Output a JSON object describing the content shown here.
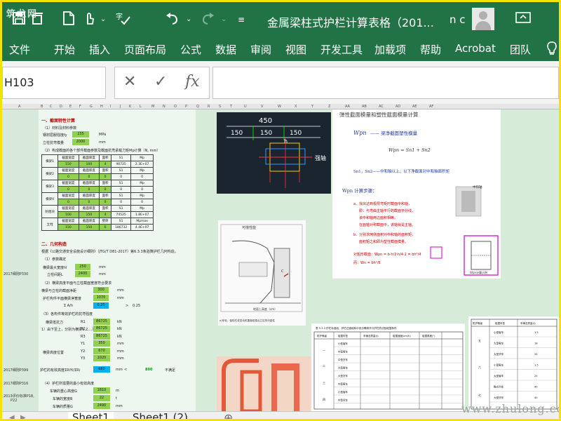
{
  "app": {
    "logo_text": "筑龙网",
    "title": "金属梁柱式护栏计算表格（201...",
    "user": "n c"
  },
  "menu": [
    "文件",
    "开始",
    "插入",
    "页面布局",
    "公式",
    "数据",
    "审阅",
    "视图",
    "开发工具",
    "加载项",
    "帮助",
    "Acrobat",
    "团队"
  ],
  "formula_bar": {
    "name_box": "H103",
    "value": ""
  },
  "columns": [
    "A",
    "B",
    "C",
    "D",
    "E",
    "F",
    "G",
    "H",
    "I",
    "J",
    "K",
    "L",
    "M",
    "N",
    "O",
    "P",
    "Q",
    "R",
    "S",
    "T",
    "U",
    "V",
    "W",
    "X",
    "Y",
    "Z",
    "AA",
    "AB",
    "AC",
    "AD",
    "AE",
    "AF"
  ],
  "sheet": {
    "section1": "一、截面特性计算",
    "s1_sub1": "（1）材料及材料参数",
    "yield_label": "钢材屈服强度fy",
    "yield_value": "235",
    "yield_unit": "MPa",
    "modulus_label": "立柱抗弯模量",
    "modulus_value": "2000",
    "modulus_unit": "mm",
    "s1_sub2": "（2）构成截面的各个部件截面参数及截面抗弯承载力矩Mp计算（N, mm）",
    "table_header": [
      "截面宽度",
      "截面厚度",
      "面积",
      "S1",
      "Mp"
    ],
    "table_rows": [
      {
        "label": "横梁1",
        "values": [
          "150",
          "100",
          "4",
          "96725",
          "2.3E+07"
        ]
      },
      {
        "label": "横梁2",
        "values": [
          "0",
          "0",
          "0",
          "0",
          "0"
        ]
      },
      {
        "label": "横梁3",
        "values": [
          "0",
          "0",
          "0",
          "0",
          "0"
        ]
      },
      {
        "label": "横梁4",
        "values": [
          "0",
          "0",
          "0",
          "0",
          "0"
        ]
      },
      {
        "label": "防阻块",
        "values": [
          "100",
          "150",
          "4",
          "74525",
          "1.8E+07"
        ]
      },
      {
        "label": "立柱",
        "values": [
          "150",
          "150",
          "6",
          "186732",
          "4.4E+07"
        ]
      }
    ],
    "table_sublabels": [
      "截面宽度",
      "截面厚度",
      "壁厚",
      "S1",
      "Mpmax"
    ],
    "section2": "二、几何构造",
    "s2_desc": "根据《公路交通安全设施设计细则》（JTG/T D81-2017）第6.3.3条验算护栏几何构造。",
    "ref_2017_a": "2017细则P330",
    "s2_sub1": "（1）参数确定",
    "ht_label": "横梁最大宽度hl",
    "ht_value": "250",
    "ht_unit": "mm",
    "dist_label": "立柱间距L",
    "dist_value": "2400",
    "dist_unit": "mm",
    "s2_sub2": "（2）横梁高度平面与立柱截面宽度符合要求",
    "c1_label": "横梁与立柱的截面净距",
    "c1_value": "300",
    "c1_unit": "mm",
    "c2_label": "护栏构件平面横梁净宽度",
    "c2_value": "1070",
    "c2_unit": "mm",
    "ratio_label": "Σ A/h",
    "ratio_value": "0.25",
    "ratio_cmp": ">",
    "ratio_limit": "0.25",
    "s2_sub3": "（3）各构件等效护栏的抗弯强度",
    "rows_r": [
      {
        "label": "R1",
        "value": "86725",
        "unit": "kN"
      },
      {
        "label": "R2",
        "value": "86725",
        "unit": "kN"
      },
      {
        "label": "R3",
        "value": "86725",
        "unit": "kN"
      },
      {
        "label": "Y1",
        "value": "350",
        "unit": "mm"
      },
      {
        "label": "Y2",
        "value": "670",
        "unit": "mm"
      },
      {
        "label": "Y3",
        "value": "1020",
        "unit": "mm"
      }
    ],
    "beam_group_label": "横梁抵抗力",
    "beam_group_sub": "1）由下至上，分别为横梁1,2,...）",
    "row_height_label": "横梁高度位置",
    "ref_2017_b": "2017细则P399",
    "eq_label": "护栏的有效高度ΣRiYi/ΣRi",
    "eq_value": "680",
    "eq_unit": "mm",
    "eq_cmp": "<",
    "eq_limit": "800",
    "eq_result": "不满足",
    "ref_2017_c": "2017细则P316",
    "s2_sub4": "（4）护栏所需要的最小有效高度",
    "min_h_label": "车辆的重心高度G",
    "min_h_value": "1810",
    "min_h_unit": "m",
    "min_w_label": "车辆的宽度B",
    "min_w_value": "22",
    "min_w_unit": "t",
    "min_l_label": "车辆的质量G",
    "min_l_value": "2490",
    "min_l_unit": "mm",
    "ref_2013": "2013评价标准P18,",
    "ref_2013b": "P22"
  },
  "embeds": {
    "cad": {
      "top_dim": "450",
      "dims": [
        "150",
        "150",
        "150"
      ],
      "side_dim": "h",
      "side_label": "强轴"
    },
    "formula": {
      "title": "弹性截面模量和塑性截面模量计算",
      "wpx_def": "—— 梁净截面塑性模量",
      "eq1": "Wpn = Sn1 + Sn2",
      "desc1": "Sn1，Sn2——中和轴以上、以下净截面对中和轴面积矩",
      "calc_title": "Wpn 计算步骤：",
      "step_a": "a．找出达到极限弯矩时截面中和轴，",
      "step_a2": "即：与弯曲主轴平行的截面平分线，",
      "step_a3": "该中和轴两边面积相等。",
      "step_a4": "在面轴对称截面中，该轴就是主轴。",
      "step_b": "b．分别求两侧面积对中和轴的面积矩，",
      "step_b2": "面积矩之和即为塑性截面模量。",
      "example": "对矩形截面：Wpn = b·h/2·h/4·2 = bh²/4",
      "example2": "而：Wn = bh²/6",
      "caption": "Wpn计算示例",
      "neutral_axis": "中和轴"
    },
    "section_diagram": {
      "title": "可撞性能",
      "caption": "a)车轮、保险杠或发动机罩盖碰撞点立柱的可能性",
      "c_label": "C",
      "axis_label": "地面上高度（cm）"
    },
    "table1": {
      "title": "表 5.3.3  护栏标准段、护栏过渡段和中央分隔带开口护栏的试验碰撞条件",
      "headers": [
        "防护等级",
        "碰撞车型",
        "车辆总质量(t)",
        "碰撞速度(km/h)",
        "碰撞角度(°)"
      ],
      "groups": [
        "一",
        "二",
        "三",
        "四"
      ],
      "types": [
        "小型客车",
        "中型客车",
        "中型货车",
        "大型客车",
        "大型货车",
        "中型客车",
        "小型客车",
        "中型货车"
      ]
    },
    "table2": {
      "headers": [
        "防护等级",
        "碰撞车型",
        "车辆总质量(t)"
      ],
      "groups": [
        "五",
        "六",
        "七"
      ],
      "types": [
        "小型客车",
        "大型客车",
        "大型货车",
        "小型客车",
        "大型客车",
        "鞍式列车",
        "大型货车"
      ],
      "weights": [
        "1.5",
        "18",
        "33",
        "1.5",
        "25",
        "40",
        "40"
      ]
    }
  },
  "tabs": [
    "Sheet1",
    "Sheet1 (2)"
  ],
  "watermark": "www.zhulong.com"
}
